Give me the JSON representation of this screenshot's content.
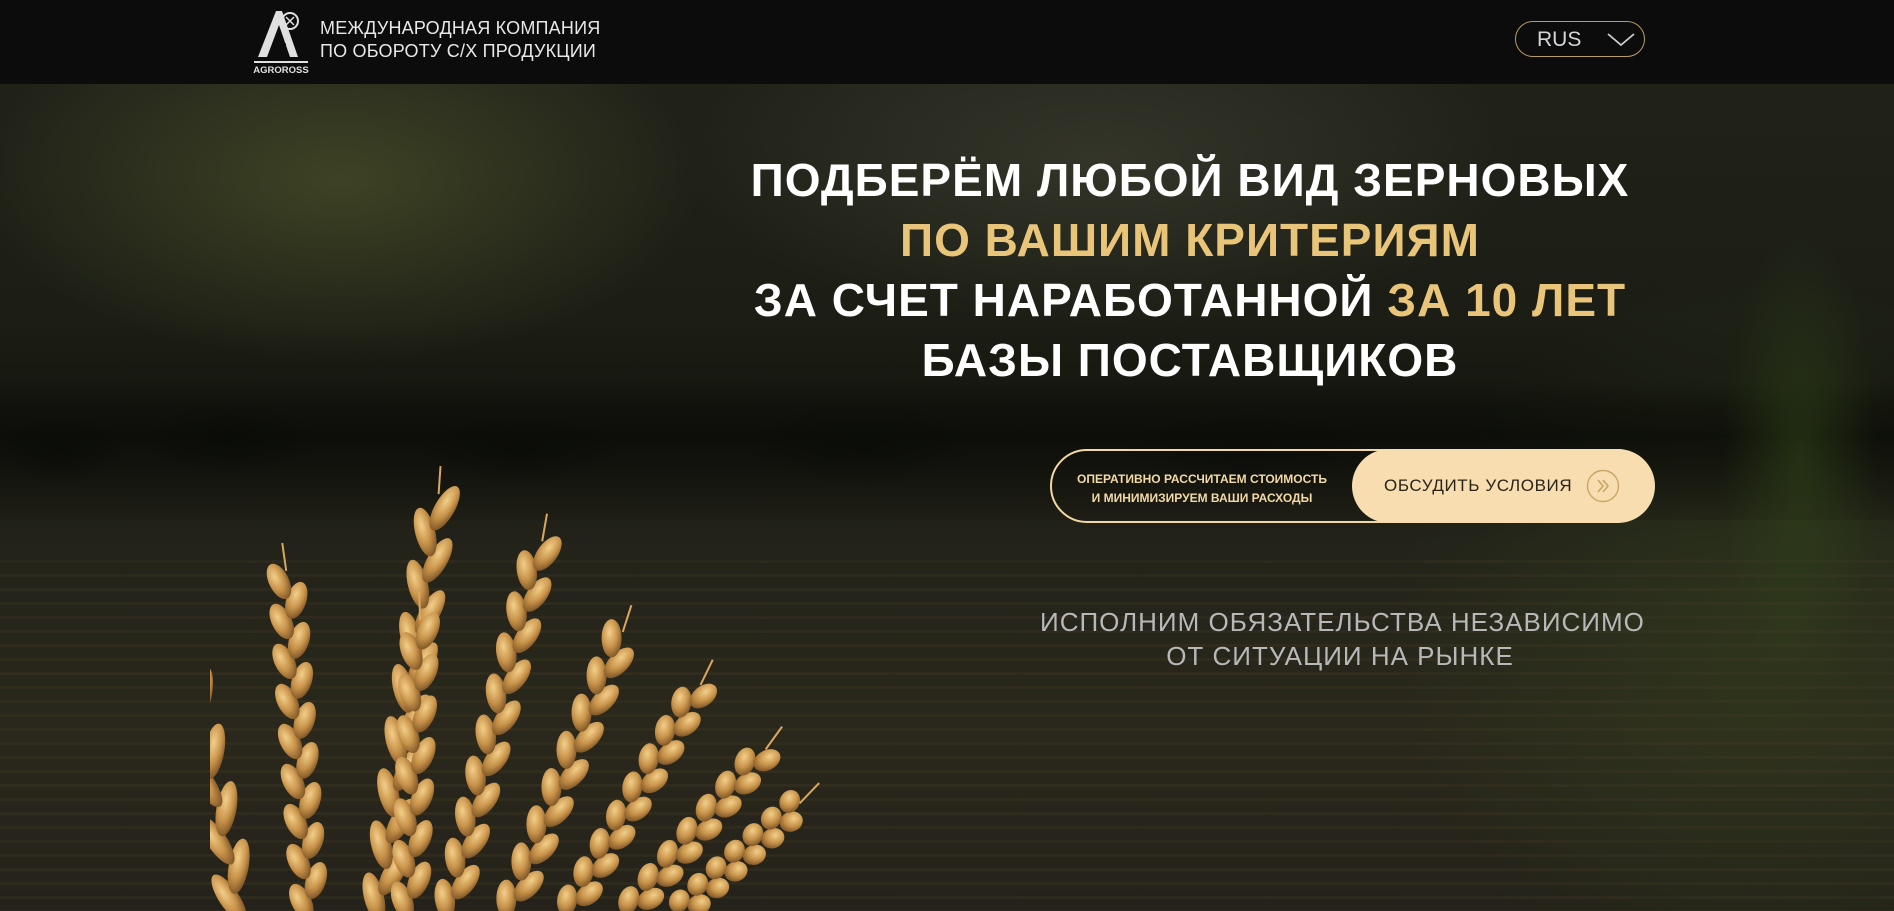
{
  "header": {
    "logo_text": "AGROROSS",
    "company_line1": "МЕЖДУНАРОДНАЯ КОМПАНИЯ",
    "company_line2": "ПО ОБОРОТУ С/Х ПРОДУКЦИИ",
    "language": "RUS"
  },
  "hero": {
    "line1": "ПОДБЕРЁМ ЛЮБОЙ ВИД ЗЕРНОВЫХ",
    "line2": "ПО ВАШИМ КРИТЕРИЯМ",
    "line3_white": "ЗА СЧЕТ НАРАБОТАННОЙ ",
    "line3_gold": "ЗА 10 ЛЕТ",
    "line4": "БАЗЫ ПОСТАВЩИКОВ"
  },
  "cta": {
    "note_line1": "ОПЕРАТИВНО РАССЧИТАЕМ СТОИМОСТЬ",
    "note_line2": "И МИНИМИЗИРУЕМ ВАШИ РАСХОДЫ",
    "button_label": "ОБСУДИТЬ УСЛОВИЯ"
  },
  "subtext": {
    "line1": "ИСПОЛНИМ ОБЯЗАТЕЛЬСТВА НЕЗАВИСИМО",
    "line2": "ОТ СИТУАЦИИ НА РЫНКЕ"
  },
  "colors": {
    "accent_gold": "#e9c57a",
    "button_fill": "#f7ddb0",
    "header_bg": "#0c0c0c"
  },
  "icons": [
    "agroross-logo",
    "chevron-down-icon",
    "double-arrow-right-icon"
  ]
}
